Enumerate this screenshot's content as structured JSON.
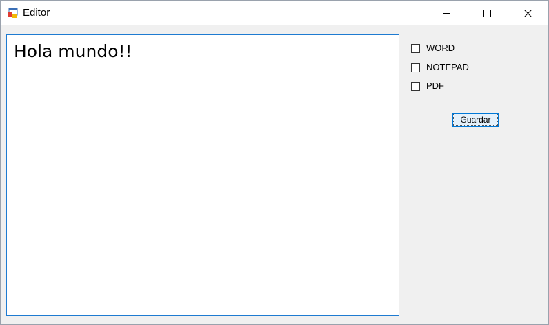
{
  "window": {
    "title": "Editor",
    "icons": {
      "app": "app-form-icon",
      "minimize": "minimize-icon",
      "maximize": "maximize-icon",
      "close": "close-icon"
    }
  },
  "editor": {
    "text": "Hola mundo!!"
  },
  "options": [
    {
      "label": "WORD",
      "checked": false
    },
    {
      "label": "NOTEPAD",
      "checked": false
    },
    {
      "label": "PDF",
      "checked": false
    }
  ],
  "actions": {
    "save_label": "Guardar"
  },
  "colors": {
    "focus_border": "#1e7bd1",
    "button_border": "#0078d7",
    "button_bg": "#e5f1fb",
    "client_bg": "#f0f0f0"
  }
}
